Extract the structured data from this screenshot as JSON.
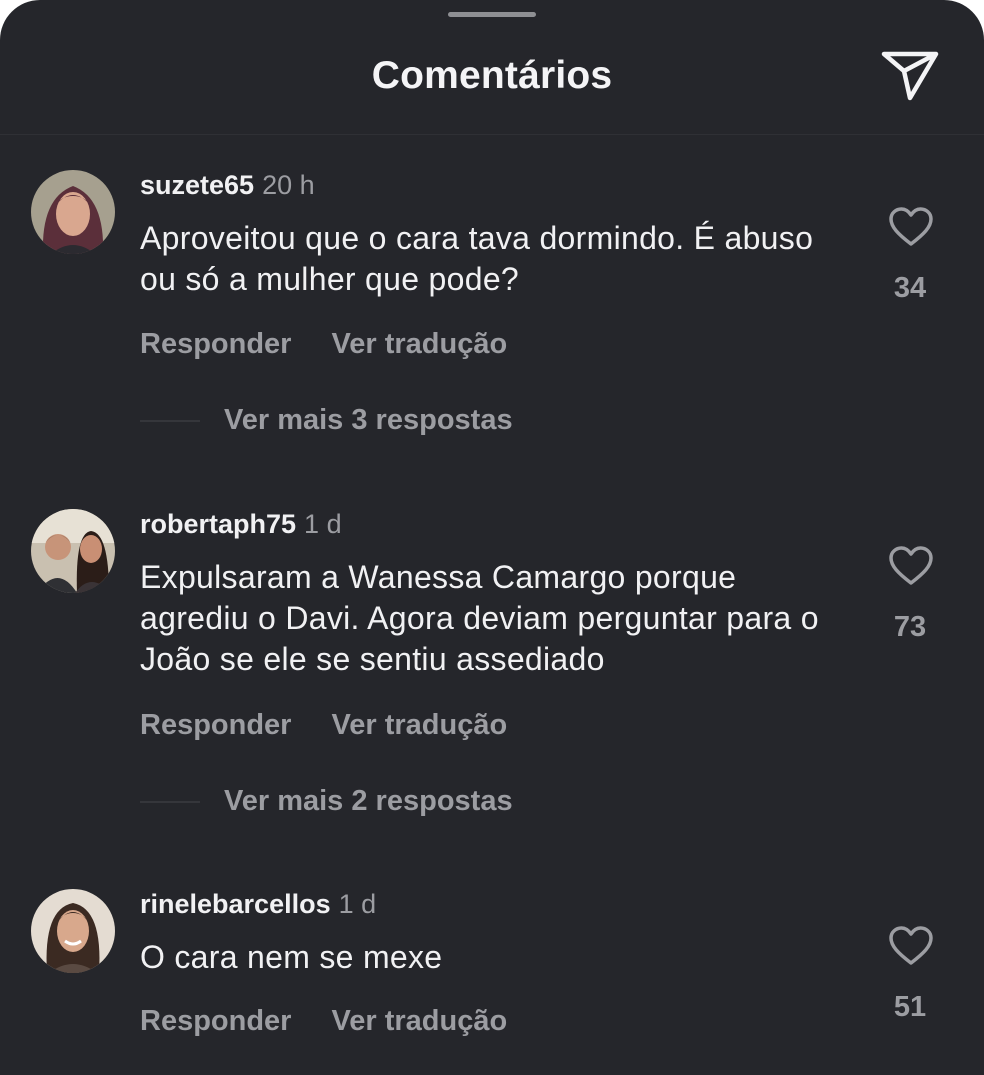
{
  "header": {
    "title": "Comentários"
  },
  "comments": [
    {
      "username": "suzete65",
      "time": "20 h",
      "text": "Aproveitou que o cara tava dormindo. É abuso ou só a mulher que pode?",
      "likes": "34",
      "reply_label": "Responder",
      "translate_label": "Ver tradução",
      "more_replies": "Ver mais 3 respostas"
    },
    {
      "username": "robertaph75",
      "time": "1 d",
      "text": "Expulsaram a Wanessa Camargo porque agrediu o Davi. Agora deviam perguntar para o João se ele se sentiu assediado",
      "likes": "73",
      "reply_label": "Responder",
      "translate_label": "Ver tradução",
      "more_replies": "Ver mais 2 respostas"
    },
    {
      "username": "rinelebarcellos",
      "time": "1 d",
      "text": "O cara nem se mexe",
      "likes": "51",
      "reply_label": "Responder",
      "translate_label": "Ver tradução"
    }
  ]
}
